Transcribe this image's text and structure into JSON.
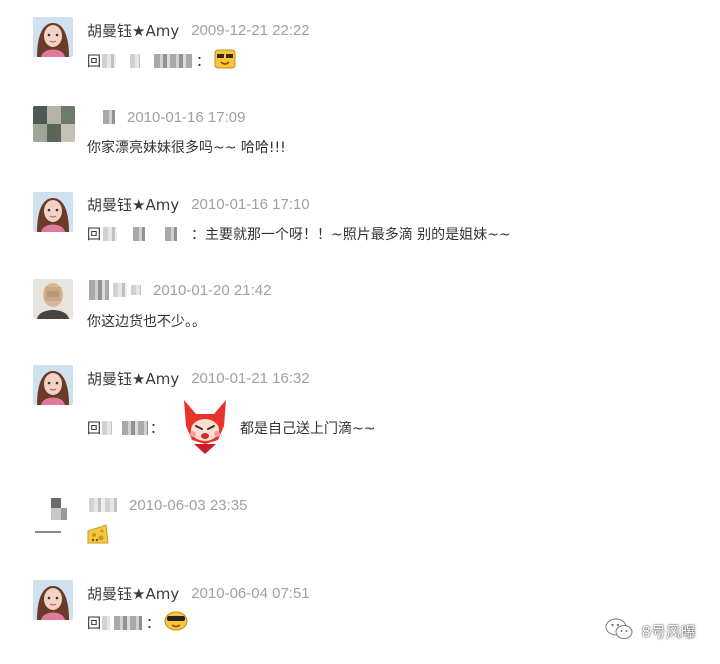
{
  "comments": [
    {
      "author": "胡曼钰★Amy",
      "time": "2009-12-21 22:22",
      "reply_prefix": "回",
      "colon": "：",
      "text": ""
    },
    {
      "author": "",
      "time": "2010-01-16 17:09",
      "text": "你家漂亮妹妹很多吗~~  哈哈!!!"
    },
    {
      "author": "胡曼钰★Amy",
      "time": "2010-01-16 17:10",
      "reply_prefix": "回",
      "colon": "：",
      "text": "主要就那一个呀！！~照片最多滴 别的是姐妹~~"
    },
    {
      "author": "",
      "time": "2010-01-20 21:42",
      "text": "你这边货也不少。。"
    },
    {
      "author": "胡曼钰★Amy",
      "time": "2010-01-21 16:32",
      "reply_prefix": "回",
      "colon": "：",
      "text": "都是自己送上门滴~~"
    },
    {
      "author": "",
      "time": "2010-06-03 23:35",
      "text": ""
    },
    {
      "author": "胡曼钰★Amy",
      "time": "2010-06-04 07:51",
      "reply_prefix": "回",
      "colon": "：",
      "text": ""
    }
  ],
  "watermark": {
    "text": "8号风曝",
    "icon": "wechat-icon"
  },
  "icons": {
    "smiley": "sunglasses-smiley-icon",
    "fox": "red-fox-emoji-icon",
    "cheese": "cheese-emoji-icon",
    "cool": "cool-face-emoji-icon"
  }
}
